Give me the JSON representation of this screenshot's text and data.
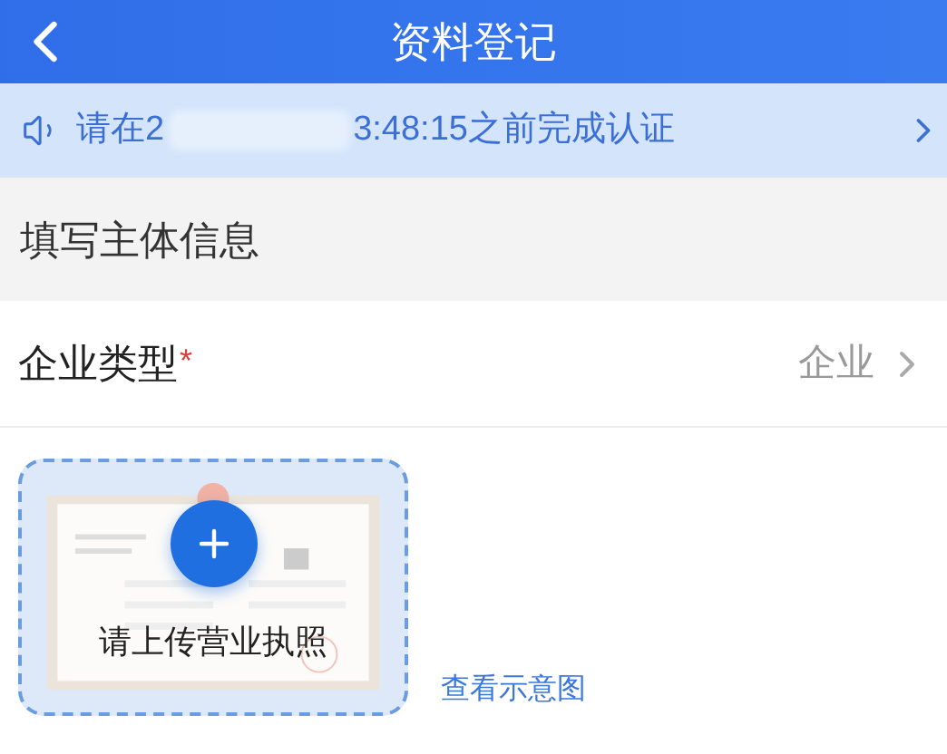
{
  "header": {
    "title": "资料登记"
  },
  "notice": {
    "text_before": "请在2",
    "text_after": "3:48:15之前完成认证"
  },
  "section": {
    "title": "填写主体信息"
  },
  "field": {
    "label": "企业类型",
    "required": true,
    "required_mark": "*",
    "value": "企业"
  },
  "upload": {
    "label": "请上传营业执照",
    "link": "查看示意图"
  }
}
